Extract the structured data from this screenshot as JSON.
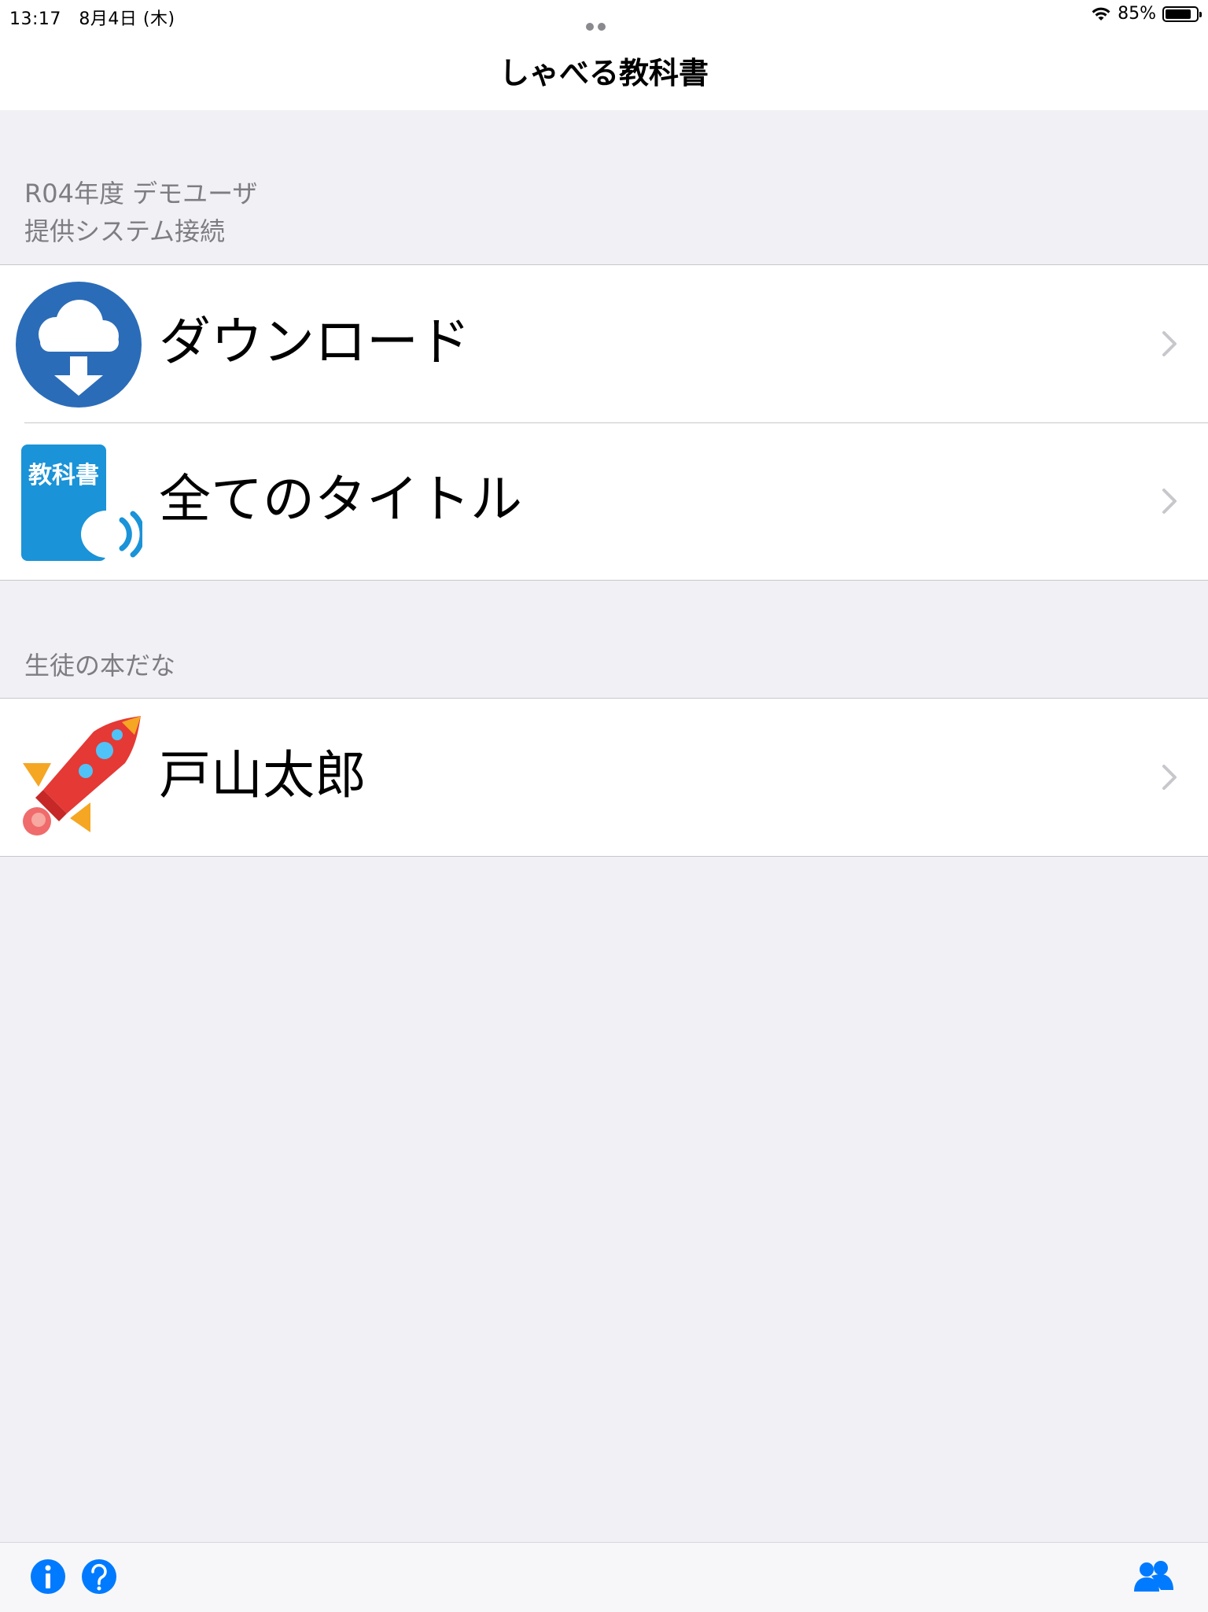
{
  "status_bar": {
    "time": "13:17",
    "date": "8月4日 (木)",
    "battery_percent": "85%",
    "battery_level": 0.85
  },
  "nav": {
    "title": "しゃべる教科書"
  },
  "sections": [
    {
      "header_line1": "R04年度 デモユーザ",
      "header_line2": "提供システム接続",
      "items": [
        {
          "label": "ダウンロード",
          "icon": "cloud-download-icon"
        },
        {
          "label": "全てのタイトル",
          "icon": "textbook-speaker-icon",
          "icon_text": "教科書"
        }
      ]
    },
    {
      "header_line1": "生徒の本だな",
      "items": [
        {
          "label": "戸山太郎",
          "icon": "rocket-icon"
        }
      ]
    }
  ],
  "toolbar": {
    "icons": [
      "info-icon",
      "help-icon",
      "users-icon"
    ]
  },
  "colors": {
    "accent_blue": "#007aff",
    "download_blue": "#2b6cb8",
    "textbook_blue": "#1a93d8",
    "background": "#f1f1f5"
  }
}
